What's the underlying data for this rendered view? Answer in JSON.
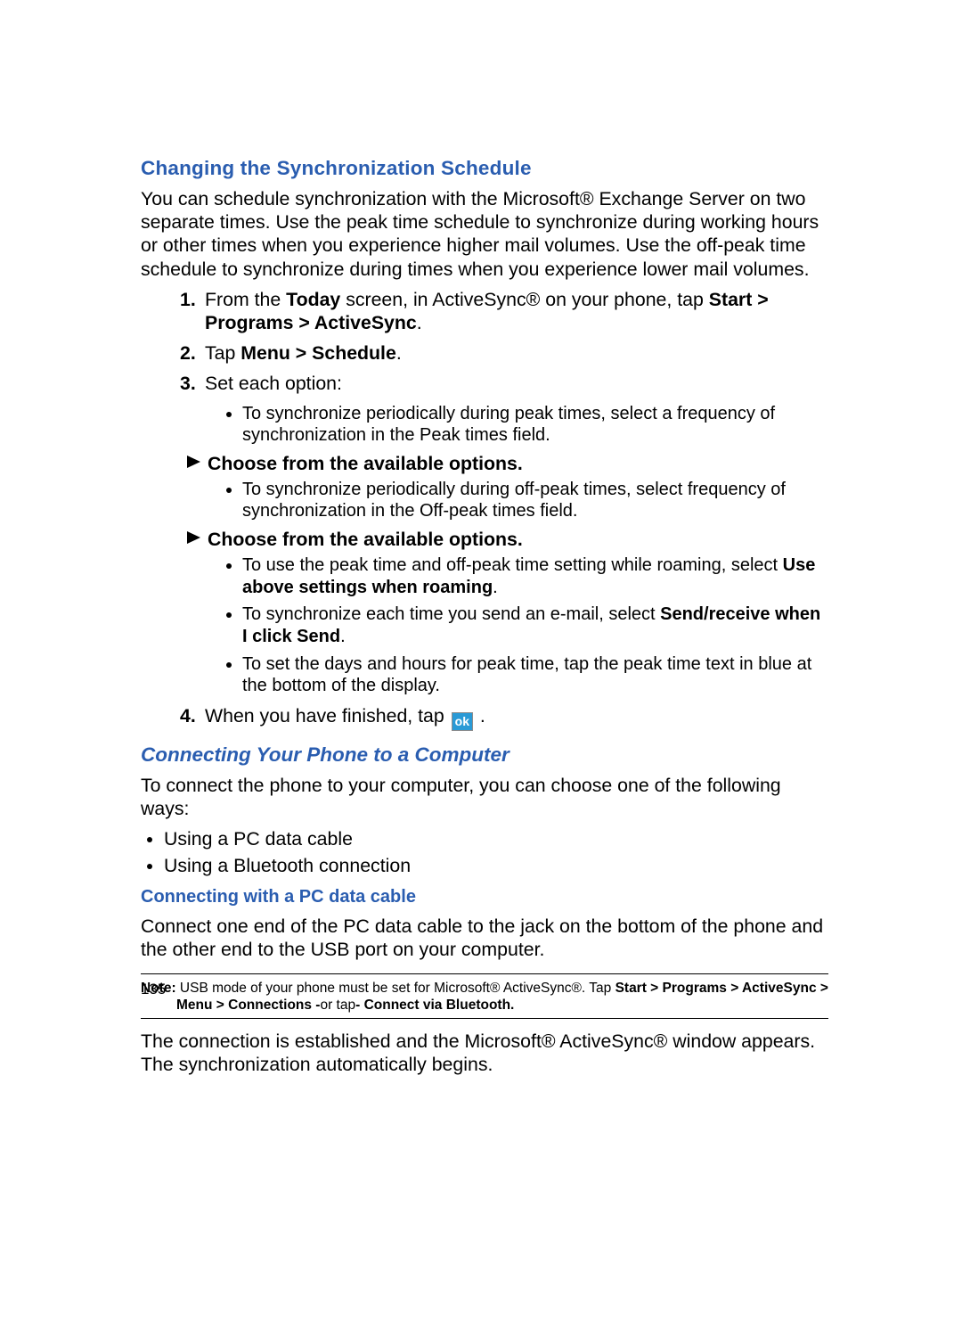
{
  "pageNumber": "135",
  "sec1": {
    "title": "Changing the Synchronization Schedule",
    "intro_a": "You can schedule synchronization with the Microsoft® Exchange Server on two separate times. Use the peak time schedule to synchronize during working hours or other times when you experience higher mail volumes. Use the off-peak time schedule to synchronize during times when you experience lower mail volumes.",
    "s1_a": "From the ",
    "s1_b": "Today",
    "s1_c": " screen, in ActiveSync® on your phone, tap ",
    "s1_d": "Start > Programs > ActiveSync",
    "s1_e": ".",
    "s2_a": "Tap ",
    "s2_b": "Menu > Schedule",
    "s2_c": ".",
    "s3": "Set each option:",
    "s3_b1": "To synchronize periodically during peak times, select a frequency of synchronization in the Peak times field.",
    "arrow1": "Choose from the available options.",
    "s3_b2": "To synchronize periodically during off-peak times, select frequency of synchronization in the Off-peak times field.",
    "arrow2": "Choose from the available options.",
    "s3_b3_a": "To use the peak time and off-peak time setting while roaming, select ",
    "s3_b3_b": "Use above settings when roaming",
    "s3_b3_c": ".",
    "s3_b4_a": "To synchronize each time you send an e-mail, select ",
    "s3_b4_b": "Send/receive when I click Send",
    "s3_b4_c": ".",
    "s3_b5": "To set the days and hours for peak time, tap the peak time text in blue at the bottom of the display.",
    "s4_a": "When you have finished, tap ",
    "s4_ok": "ok",
    "s4_b": " ."
  },
  "sec2": {
    "title": "Connecting Your Phone to a Computer",
    "intro": "To connect the phone to your computer, you can choose one of the following ways:",
    "li1": "Using a PC data cable",
    "li2": "Using a Bluetooth connection",
    "sub_h": "Connecting with a PC data cable",
    "sub_p": "Connect one end of the PC data cable to the jack on the bottom of the phone and the other end to the USB port on your computer.",
    "note_lbl": "Note:",
    "note_a": " USB mode of your phone must be set for Microsoft® ActiveSync®. Tap ",
    "note_b": "Start > Programs > ActiveSync > Menu > Connections -",
    "note_c": "or tap",
    "note_d": "- Connect via Bluetooth.",
    "after": "The connection is established and the Microsoft® ActiveSync® window appears. The synchronization automatically begins."
  }
}
